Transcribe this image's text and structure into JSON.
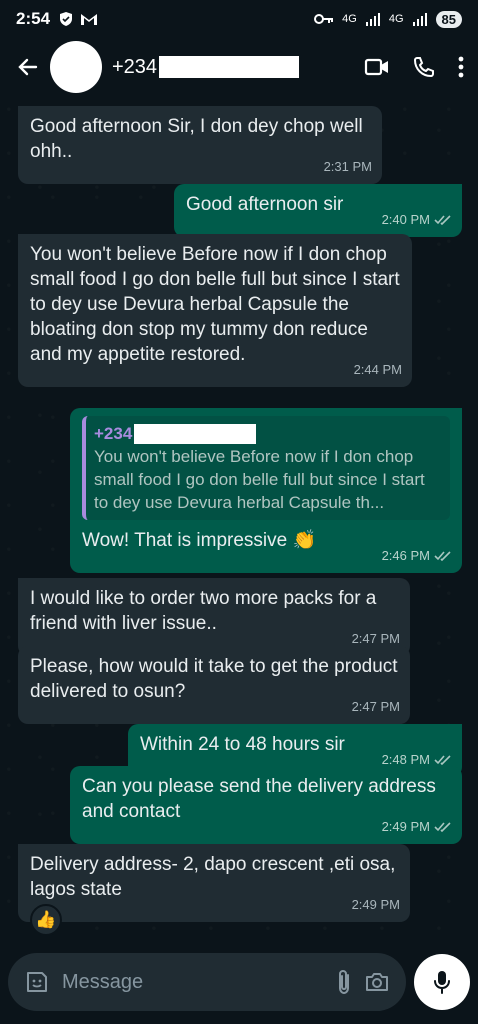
{
  "status_bar": {
    "time": "2:54",
    "network_1": "4G",
    "network_2": "4G",
    "battery": "85"
  },
  "header": {
    "contact_prefix": "+234",
    "icons": [
      "back-arrow-icon",
      "video-call-icon",
      "voice-call-icon",
      "more-options-icon"
    ]
  },
  "messages": [
    {
      "dir": "in",
      "text": "Good afternoon Sir, I don dey chop well ohh..",
      "time": "2:31 PM"
    },
    {
      "dir": "out",
      "text": "Good afternoon sir",
      "time": "2:40 PM",
      "read": true
    },
    {
      "dir": "in",
      "text": "You won't believe Before now if I don chop small food I go don belle full but since I start to dey use Devura herbal Capsule the bloating don stop my tummy don reduce and my appetite restored.",
      "time": "2:44 PM"
    },
    {
      "dir": "out",
      "quote_name": "+234",
      "quote_text": "You won't believe Before now if I don chop small food I go don belle full but since I start to dey use Devura herbal Capsule th...",
      "text": "Wow! That is impressive 👏",
      "time": "2:46 PM",
      "read": true
    },
    {
      "dir": "in",
      "text": "I would like to order two more packs for a friend with liver issue..",
      "time": "2:47 PM"
    },
    {
      "dir": "in",
      "text": "Please, how would it take to get the product delivered to osun?",
      "time": "2:47 PM"
    },
    {
      "dir": "out",
      "text": "Within 24 to 48 hours sir",
      "time": "2:48 PM",
      "read": true
    },
    {
      "dir": "out",
      "text": "Can you please send the delivery address and contact",
      "time": "2:49 PM",
      "read": true
    },
    {
      "dir": "in",
      "text": "Delivery address- 2, dapo crescent ,eti osa, lagos state",
      "time": "2:49 PM",
      "reaction": "👍"
    }
  ],
  "composer": {
    "placeholder": "Message"
  },
  "colors": {
    "background": "#0b141a",
    "incoming_bubble": "#202c33",
    "outgoing_bubble": "#005c4b",
    "read_tick": "#a9c7c1",
    "quote_accent": "#a78bde"
  }
}
